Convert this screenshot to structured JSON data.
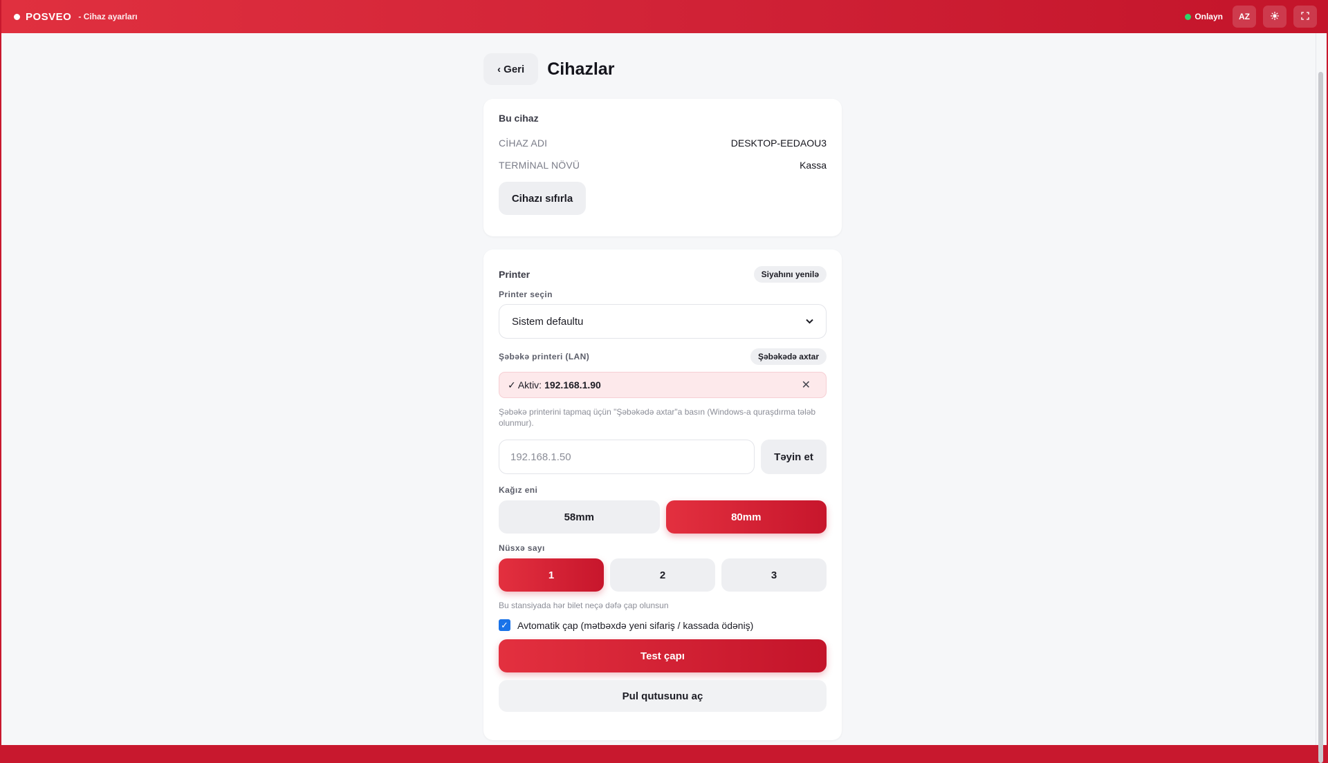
{
  "topbar": {
    "brand": "POSVEO",
    "subtitle": "- Cihaz ayarları",
    "status": "Onlayn",
    "lang": "AZ",
    "theme_icon": "sun-icon",
    "fullscreen_icon": "fullscreen-icon",
    "status_color": "#2fd36a",
    "accent": "#d12337"
  },
  "header": {
    "back_label": "‹ Geri",
    "title": "Cihazlar"
  },
  "device": {
    "title": "Bu cihaz",
    "name_label": "CİHAZ ADI",
    "name_value": "DESKTOP-EEDAOU3",
    "terminal_label": "TERMİNAL NÖVÜ",
    "terminal_value": "Kassa",
    "reset_label": "Cihazı sıfırla"
  },
  "printer": {
    "title": "Printer",
    "refresh_label": "Siyahını yenilə",
    "select_label": "Printer seçin",
    "select_value": "Sistem defaultu",
    "lan_label": "Şəbəkə printeri (LAN)",
    "scan_label": "Şəbəkədə axtar",
    "active_prefix": "✓ Aktiv:",
    "active_ip": "192.168.1.90",
    "hint": "Şəbəkə printerini tapmaq üçün \"Şəbəkədə axtar\"a basın (Windows-a quraşdırma tələb olunmur).",
    "ip_placeholder": "192.168.1.50",
    "assign_label": "Təyin et",
    "paper_label": "Kağız eni",
    "paper_options": [
      "58mm",
      "80mm"
    ],
    "paper_selected": "80mm",
    "copies_label": "Nüsxə sayı",
    "copies_options": [
      "1",
      "2",
      "3"
    ],
    "copies_selected": "1",
    "copies_hint": "Bu stansiyada hər bilet neçə dəfə çap olunsun",
    "auto_print_label": "Avtomatik çap (mətbəxdə yeni sifariş / kassada ödəniş)",
    "auto_print_checked": true,
    "test_label": "Test çapı",
    "drawer_label": "Pul qutusunu aç"
  }
}
